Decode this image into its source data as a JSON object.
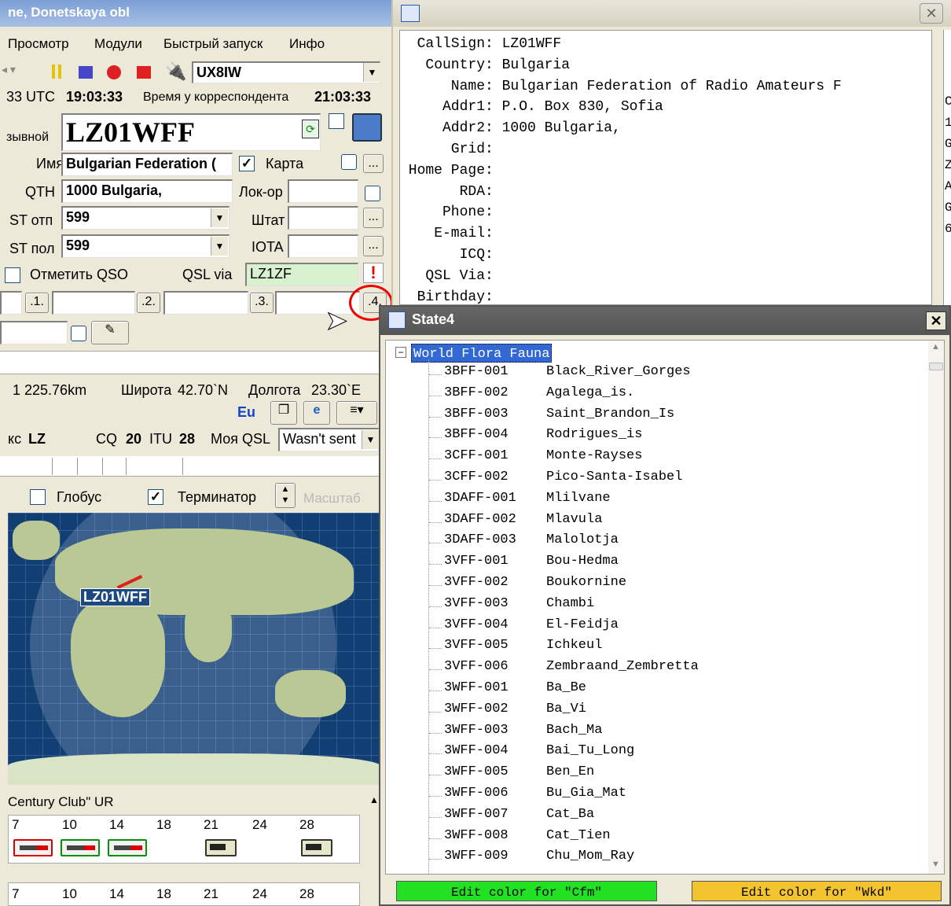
{
  "left": {
    "title_fragment": "ne, Donetskaya obl",
    "menu": [
      "Просмотр",
      "Модули",
      "Быстрый запуск",
      "Инфо"
    ],
    "operator_callsign": "UX8IW",
    "time_row": {
      "utc_prefix": "33 UTC",
      "utc_time": "19:03:33",
      "corr_label": "Время у корреспондента",
      "corr_time": "21:03:33"
    },
    "callsign_label": "зывной",
    "callsign": "LZ01WFF",
    "name_label": "Имя",
    "name_value": "Bulgarian Federation (",
    "map_label": "Карта",
    "qth_label": "QTH",
    "qth_value": "1000 Bulgaria,",
    "locator_label": "Лок-ор",
    "rst_sent_label": "ST отп",
    "rst_sent": "599",
    "state_label": "Штат",
    "rst_rcvd_label": "ST пол",
    "rst_rcvd": "599",
    "iota_label": "IOTA",
    "mark_qso_label": "Отметить QSO",
    "qsl_via_label": "QSL via",
    "qsl_via_value": "LZ1ZF",
    "slots": [
      ".1.",
      ".2.",
      ".3.",
      ".4."
    ],
    "distance": "1 225.76km",
    "lat_label": "Широта",
    "lat_value": "42.70`N",
    "lon_label": "Долгота",
    "lon_value": "23.30`E",
    "continent": "Eu",
    "prefix_label": "кс",
    "prefix_value": "LZ",
    "cq_label": "CQ",
    "cq_value": "20",
    "itu_label": "ITU",
    "itu_value": "28",
    "my_qsl_label": "Моя QSL",
    "my_qsl_value": "Wasn't sent",
    "globe_label": "Глобус",
    "terminator_label": "Терминатор",
    "scale_label": "Масштаб",
    "map_callsign": "LZ01WFF",
    "award_title": "Century Club\" UR",
    "bands": [
      "7",
      "10",
      "14",
      "18",
      "21",
      "24",
      "28"
    ],
    "bands_row2": [
      "7",
      "10",
      "14",
      "18",
      "21",
      "24",
      "28"
    ]
  },
  "info": {
    "lines": [
      {
        "key": "CallSign:",
        "value": "LZ01WFF"
      },
      {
        "key": "Country:",
        "value": "Bulgaria"
      },
      {
        "key": "Name:",
        "value": "Bulgarian Federation of Radio Amateurs F"
      },
      {
        "key": "Addr1:",
        "value": "P.O. Box 830, Sofia"
      },
      {
        "key": "Addr2:",
        "value": "1000 Bulgaria,"
      },
      {
        "key": "Grid:",
        "value": ""
      },
      {
        "key": "Home Page:",
        "value": ""
      },
      {
        "key": "RDA:",
        "value": ""
      },
      {
        "key": "Phone:",
        "value": ""
      },
      {
        "key": "E-mail:",
        "value": ""
      },
      {
        "key": "ICQ:",
        "value": ""
      },
      {
        "key": "QSL Via:",
        "value": ""
      },
      {
        "key": "Birthday:",
        "value": ""
      }
    ],
    "edge_chars": [
      "C",
      "1",
      "G",
      "Z",
      "A",
      "G",
      "6"
    ]
  },
  "state4": {
    "title": "State4",
    "root": "World Flora Fauna",
    "items": [
      {
        "code": "3BFF-001",
        "name": "Black_River_Gorges"
      },
      {
        "code": "3BFF-002",
        "name": "Agalega_is."
      },
      {
        "code": "3BFF-003",
        "name": "Saint_Brandon_Is"
      },
      {
        "code": "3BFF-004",
        "name": "Rodrigues_is"
      },
      {
        "code": "3CFF-001",
        "name": "Monte-Rayses"
      },
      {
        "code": "3CFF-002",
        "name": "Pico-Santa-Isabel"
      },
      {
        "code": "3DAFF-001",
        "name": "Mlilvane"
      },
      {
        "code": "3DAFF-002",
        "name": "Mlavula"
      },
      {
        "code": "3DAFF-003",
        "name": "Malolotja"
      },
      {
        "code": "3VFF-001",
        "name": "Bou-Hedma"
      },
      {
        "code": "3VFF-002",
        "name": "Boukornine"
      },
      {
        "code": "3VFF-003",
        "name": "Chambi"
      },
      {
        "code": "3VFF-004",
        "name": "El-Feidja"
      },
      {
        "code": "3VFF-005",
        "name": "Ichkeul"
      },
      {
        "code": "3VFF-006",
        "name": "Zembraand_Zembretta"
      },
      {
        "code": "3WFF-001",
        "name": "Ba_Be"
      },
      {
        "code": "3WFF-002",
        "name": "Ba_Vi"
      },
      {
        "code": "3WFF-003",
        "name": "Bach_Ma"
      },
      {
        "code": "3WFF-004",
        "name": "Bai_Tu_Long"
      },
      {
        "code": "3WFF-005",
        "name": "Ben_En"
      },
      {
        "code": "3WFF-006",
        "name": "Bu_Gia_Mat"
      },
      {
        "code": "3WFF-007",
        "name": "Cat_Ba"
      },
      {
        "code": "3WFF-008",
        "name": "Cat_Tien"
      },
      {
        "code": "3WFF-009",
        "name": "Chu_Mom_Ray"
      }
    ],
    "cfm_button": "Edit color for \"Cfm\"",
    "wkd_button": "Edit color for \"Wkd\"",
    "cfm_color": "#22e022",
    "wkd_color": "#f4c430"
  }
}
